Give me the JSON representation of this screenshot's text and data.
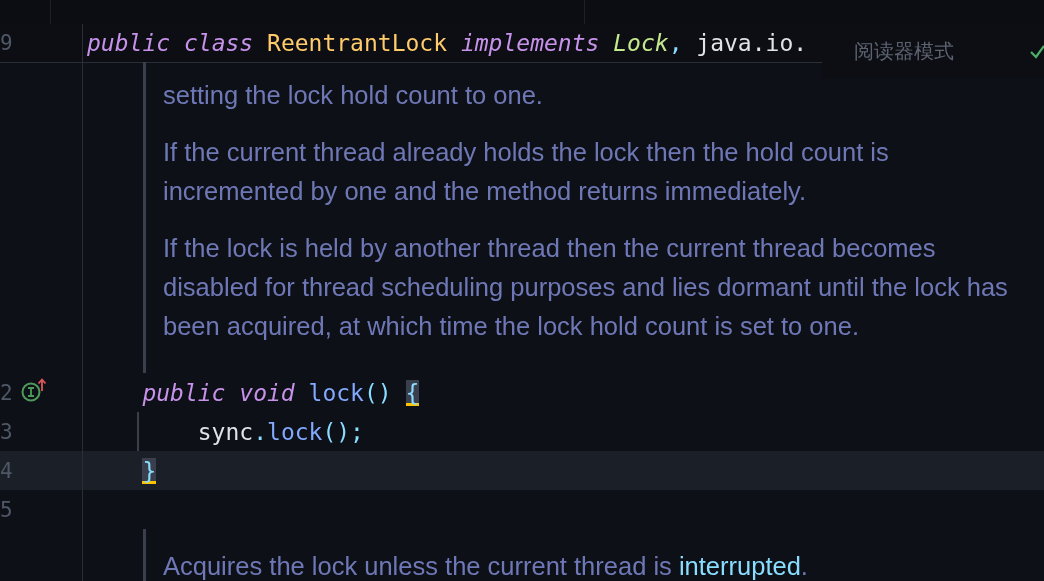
{
  "editor": {
    "sticky_line": {
      "line_number": "9",
      "tokens": [
        {
          "kind": "keyword",
          "text": "public "
        },
        {
          "kind": "keyword",
          "text": "class "
        },
        {
          "kind": "class",
          "text": "ReentrantLock "
        },
        {
          "kind": "keyword",
          "text": "implements "
        },
        {
          "kind": "interface",
          "text": "Lock"
        },
        {
          "kind": "punct",
          "text": ", "
        },
        {
          "kind": "plain",
          "text": "java.io."
        }
      ]
    },
    "reader_mode": {
      "label": "阅读器模式"
    },
    "blocks": [
      {
        "kind": "doc",
        "paragraphs": [
          [
            {
              "text": "setting the lock hold count to one.",
              "link": false
            }
          ],
          [
            {
              "text": "If the current thread already holds the lock then the hold count is\nincremented by one and the method returns immediately.",
              "link": false
            }
          ],
          [
            {
              "text": "If the lock is held by another thread then the current thread becomes\ndisabled for thread scheduling purposes and lies dormant until the lock has\nbeen acquired, at which time the lock hold count is set to one.",
              "link": false
            }
          ]
        ]
      },
      {
        "kind": "code",
        "line_number": "2",
        "marker": true,
        "current": false,
        "indent_guide": false,
        "tokens": [
          {
            "kind": "keyword",
            "text": "    public "
          },
          {
            "kind": "keyword",
            "text": "void "
          },
          {
            "kind": "method",
            "text": "lock"
          },
          {
            "kind": "punct",
            "text": "() "
          },
          {
            "kind": "brace",
            "text": "{",
            "matched": true
          }
        ]
      },
      {
        "kind": "code",
        "line_number": "3",
        "marker": false,
        "current": false,
        "indent_guide": true,
        "tokens": [
          {
            "kind": "plain",
            "text": "        sync"
          },
          {
            "kind": "punct",
            "text": "."
          },
          {
            "kind": "method",
            "text": "lock"
          },
          {
            "kind": "punct",
            "text": "();"
          }
        ]
      },
      {
        "kind": "code",
        "line_number": "4",
        "marker": false,
        "current": true,
        "indent_guide": false,
        "tokens": [
          {
            "kind": "brace",
            "text": "    }",
            "matched": true
          }
        ]
      },
      {
        "kind": "code",
        "line_number": "5",
        "marker": false,
        "current": false,
        "indent_guide": false
      },
      {
        "kind": "doc",
        "paragraphs": [
          [
            {
              "text": "Acquires the lock unless the current thread is ",
              "link": false
            },
            {
              "text": "interrupted",
              "link": true
            },
            {
              "text": ".",
              "link": false
            }
          ]
        ]
      }
    ]
  }
}
